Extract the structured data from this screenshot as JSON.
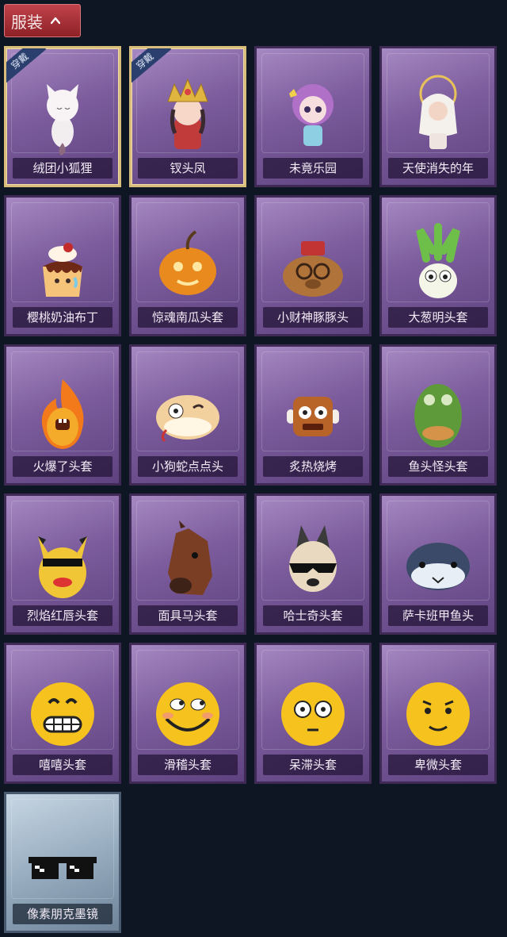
{
  "header": {
    "title": "服装",
    "toggle_icon": "chevron-up-icon"
  },
  "worn_tag": "穿戴",
  "items": [
    {
      "label": "绒团小狐狸",
      "worn": true,
      "icon": "fox-icon"
    },
    {
      "label": "钗头凤",
      "worn": true,
      "icon": "crown-girl-icon"
    },
    {
      "label": "未竟乐园",
      "worn": false,
      "icon": "doll-icon"
    },
    {
      "label": "天使消失的年",
      "worn": false,
      "icon": "angel-icon"
    },
    {
      "label": "樱桃奶油布丁",
      "worn": false,
      "icon": "pudding-icon"
    },
    {
      "label": "惊魂南瓜头套",
      "worn": false,
      "icon": "pumpkin-icon"
    },
    {
      "label": "小财神豚豚头",
      "worn": false,
      "icon": "capybara-icon"
    },
    {
      "label": "大葱明头套",
      "worn": false,
      "icon": "scallion-icon"
    },
    {
      "label": "火爆了头套",
      "worn": false,
      "icon": "fire-icon"
    },
    {
      "label": "小狗蛇点点头",
      "worn": false,
      "icon": "snake-icon"
    },
    {
      "label": "炙热烧烤",
      "worn": false,
      "icon": "meat-icon"
    },
    {
      "label": "鱼头怪头套",
      "worn": false,
      "icon": "fish-mask-icon"
    },
    {
      "label": "烈焰红唇头套",
      "worn": false,
      "icon": "pikachu-mask-icon"
    },
    {
      "label": "面具马头套",
      "worn": false,
      "icon": "horse-mask-icon"
    },
    {
      "label": "哈士奇头套",
      "worn": false,
      "icon": "husky-mask-icon"
    },
    {
      "label": "萨卡班甲鱼头",
      "worn": false,
      "icon": "blob-fish-icon"
    },
    {
      "label": "嘻嘻头套",
      "worn": false,
      "icon": "grin-emoji-icon"
    },
    {
      "label": "滑稽头套",
      "worn": false,
      "icon": "funny-emoji-icon"
    },
    {
      "label": "呆滞头套",
      "worn": false,
      "icon": "stare-emoji-icon"
    },
    {
      "label": "卑微头套",
      "worn": false,
      "icon": "humble-emoji-icon"
    },
    {
      "label": "像素朋克墨镜",
      "worn": false,
      "icon": "pixel-sunglasses-icon",
      "rarity": "blue"
    }
  ]
}
